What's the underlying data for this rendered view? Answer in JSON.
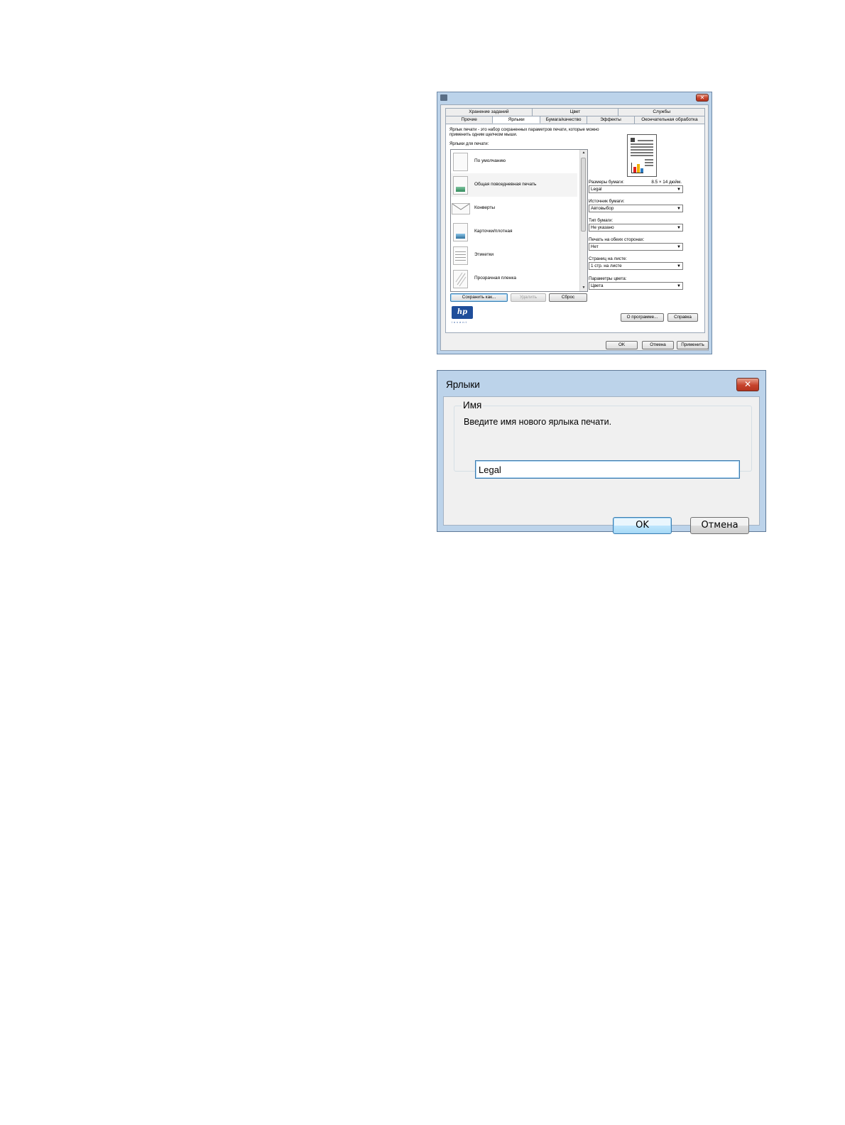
{
  "printer_window": {
    "tabs_back": [
      "Хранение заданий",
      "Цвет",
      "Службы"
    ],
    "tabs_front": [
      "Прочие",
      "Ярлыки",
      "Бумага/качество",
      "Эффекты",
      "Окончательная обработка"
    ],
    "active_tab": "Ярлыки",
    "intro_text": "Ярлык печати - это набор сохраненных параметров печати, которые можно применить одним щелчком мыши.",
    "list_label": "Ярлыки для печати:",
    "shortcuts": [
      {
        "label": "По умолчанию",
        "icon": "blank-page-icon"
      },
      {
        "label": "Общая повседневная печать",
        "icon": "photo-page-icon"
      },
      {
        "label": "Конверты",
        "icon": "envelope-icon"
      },
      {
        "label": "Карточки/плотная",
        "icon": "card-stock-icon"
      },
      {
        "label": "Этикетки",
        "icon": "labels-icon"
      },
      {
        "label": "Прозрачная пленка",
        "icon": "transparency-icon"
      }
    ],
    "selected_shortcut": "Общая повседневная печать",
    "fields": [
      {
        "label": "Размеры бумаги:",
        "extra": "8.5 × 14 дюйм.",
        "value": "Legal"
      },
      {
        "label": "Источник бумаги:",
        "value": "Автовыбор"
      },
      {
        "label": "Тип бумаги:",
        "value": "Не указано"
      },
      {
        "label": "Печать на обеих сторонах:",
        "value": "Нет"
      },
      {
        "label": "Страниц на листе:",
        "value": "1 стр. на листе"
      },
      {
        "label": "Параметры цвета:",
        "value": "Цвета"
      }
    ],
    "buttons": {
      "save_as": "Сохранить как...",
      "delete": "Удалить",
      "reset": "Сброс",
      "about": "О программе...",
      "help": "Справка",
      "ok": "OK",
      "cancel": "Отмена",
      "apply": "Применить"
    },
    "logo": {
      "text": "hp",
      "sub": "invent",
      "color": "#1f4e9a"
    }
  },
  "name_dialog": {
    "title": "Ярлыки",
    "group_label": "Имя",
    "prompt": "Введите имя нового ярлыка печати.",
    "input_value": "Legal",
    "ok": "OK",
    "cancel": "Отмена"
  },
  "colors": {
    "window_frame": "#bcd3ea",
    "close_button": "#c6432c",
    "focus_border": "#3c7fb1"
  }
}
